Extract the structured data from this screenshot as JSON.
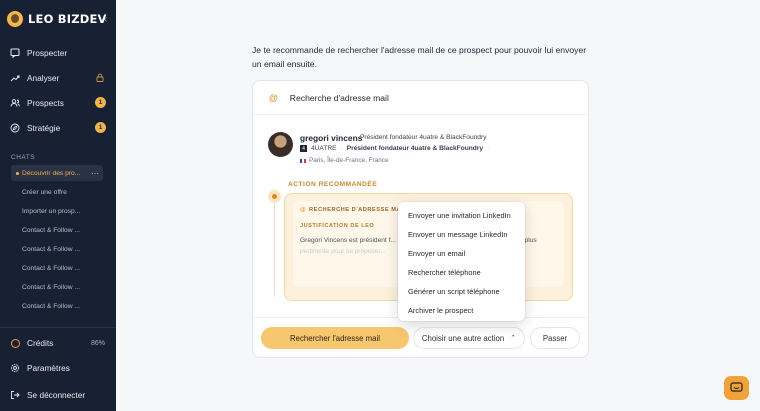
{
  "app": {
    "brand_name": "LEO BIZDEV"
  },
  "sidebar": {
    "collapse_icon": "chevron-left-icon",
    "nav": [
      {
        "label": "Prospecter",
        "icon": "message-square-icon"
      },
      {
        "label": "Analyser",
        "icon": "trending-up-icon",
        "locked": true
      },
      {
        "label": "Prospects",
        "icon": "users-icon",
        "badge": "1"
      },
      {
        "label": "Stratégie",
        "icon": "compass-icon",
        "badge": "1"
      }
    ],
    "chats_label": "CHATS",
    "chats": [
      {
        "label": "Découvrir des pro...",
        "active": true
      },
      {
        "label": "Créer une offre"
      },
      {
        "label": "Importer un prosp..."
      },
      {
        "label": "Contact & Follow ..."
      },
      {
        "label": "Contact & Follow ..."
      },
      {
        "label": "Contact & Follow ..."
      },
      {
        "label": "Contact & Follow ..."
      },
      {
        "label": "Contact & Follow ..."
      }
    ],
    "credits": {
      "label": "Crédits",
      "value": "86%"
    },
    "settings_label": "Paramètres",
    "logout_label": "Se déconnecter"
  },
  "main": {
    "intro": "Je te recommande de rechercher l'adresse mail de ce prospect pour pouvoir lui envoyer un email ensuite.",
    "card": {
      "title": "Recherche d'adresse mail",
      "prospect": {
        "name": "gregori vincens",
        "role": "Président fondateur 4uatre & BlackFoundry",
        "company": "4UATRE",
        "company_role": "Président fondateur 4uatre & BlackFoundry",
        "location": "Paris, Île-de-France, France"
      },
      "recommended_label": "ACTION RECOMMANDÉE",
      "action_title": "RECHERCHE D'ADRESSE MAIL",
      "justification_label": "JUSTIFICATION DE LEO",
      "justification_text": "Gregori Vincens est président f... ve sur des grands comptes, un profil ... ura plus",
      "justification_faded": "pertinente pour lui proposer..."
    },
    "actions": {
      "primary": "Rechercher l'adresse mail",
      "other": "Choisir une autre action",
      "skip": "Passer"
    },
    "dropdown": [
      "Envoyer une invitation LinkedIn",
      "Envoyer un message LinkedIn",
      "Envoyer un email",
      "Rechercher téléphone",
      "Générer un script téléphone",
      "Archiver le prospect"
    ]
  },
  "colors": {
    "sidebar_bg": "#182033",
    "accent": "#f0a23c",
    "primary_button": "#f6c76e"
  }
}
